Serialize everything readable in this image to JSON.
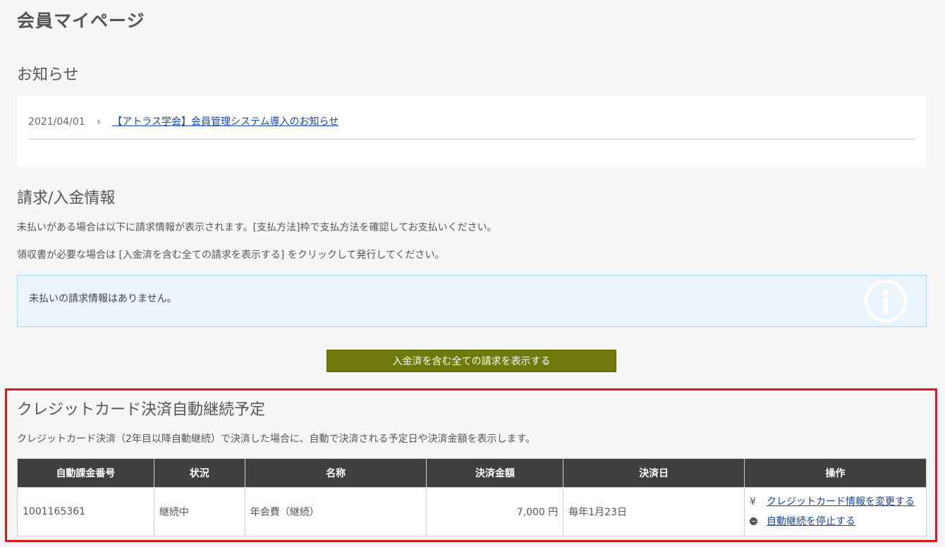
{
  "page_title": "会員マイページ",
  "news": {
    "title": "お知らせ",
    "items": [
      {
        "date": "2021/04/01",
        "chevron": "›",
        "text": "【アトラス学会】会員管理システム導入のお知らせ"
      }
    ]
  },
  "billing": {
    "title": "請求/入金情報",
    "para1": "未払いがある場合は以下に請求情報が表示されます。[支払方法]枠で支払方法を確認してお支払いください。",
    "para2": "領収書が必要な場合は [入金済を含む全ての請求を表示する] をクリックして発行してください。",
    "info_message": "未払いの請求情報はありません。",
    "info_icon": "info-icon",
    "show_all_button": "入金済を含む全ての請求を表示する"
  },
  "credit": {
    "title": "クレジットカード決済自動継続予定",
    "description": "クレジットカード決済（2年目以降自動継続）で決済した場合に、自動で決済される予定日や決済金額を表示します。",
    "headers": [
      "自動課金番号",
      "状況",
      "名称",
      "決済金額",
      "決済日",
      "操作"
    ],
    "rows": [
      {
        "id": "1001165361",
        "status": "継続中",
        "name": "年会費（継続）",
        "amount": "7,000 円",
        "date": "毎年1月23日",
        "ops": [
          {
            "icon": "yen-icon",
            "glyph": "¥",
            "label": "クレジットカード情報を変更する"
          },
          {
            "icon": "stop-circle-icon",
            "label": "自動継続を停止する"
          }
        ]
      }
    ]
  },
  "colors": {
    "button_bg": "#6f7a0a",
    "highlight_border": "#e0141e",
    "table_header_bg": "#3f3f3f",
    "info_bg": "#eaf4fc",
    "link": "#1a46a8"
  }
}
